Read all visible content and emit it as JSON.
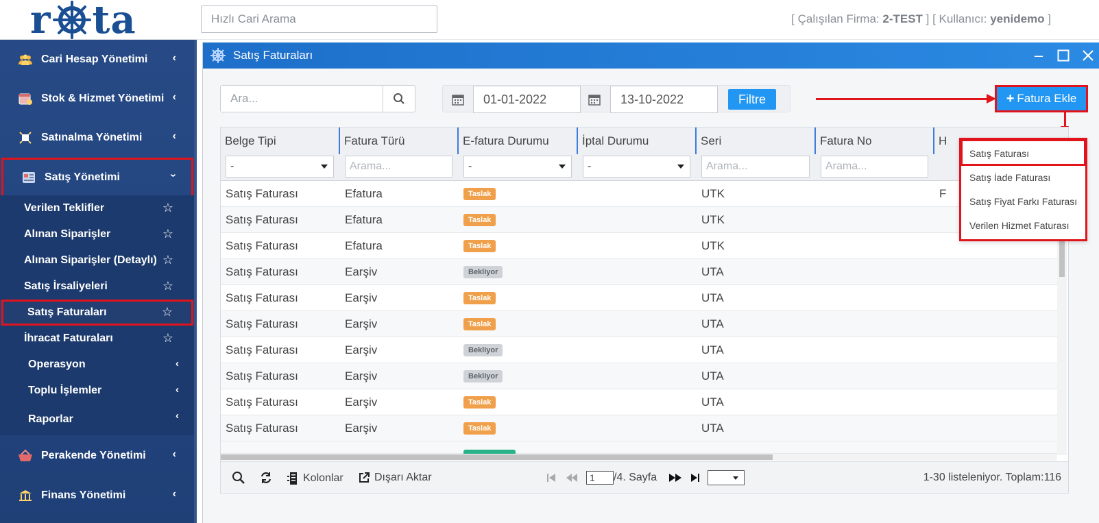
{
  "header": {
    "logo_text": "rota",
    "quick_search_placeholder": "Hızlı Cari Arama",
    "firm_label": "[ Çalışılan Firma: ",
    "firm_value": "2-TEST",
    "user_label": " ] [ Kullanıcı: ",
    "user_value": "yenidemo",
    "user_suffix": " ]"
  },
  "sidebar": {
    "main_items": [
      {
        "label": "Cari Hesap Yönetimi",
        "icon": "users-icon"
      },
      {
        "label": "Stok & Hizmet Yönetimi",
        "icon": "calendar-box-icon"
      },
      {
        "label": "Satınalma Yönetimi",
        "icon": "bug-icon"
      },
      {
        "label": "Satış Yönetimi",
        "icon": "invoice-icon",
        "active": true
      }
    ],
    "sub_items": [
      {
        "label": "Verilen Teklifler"
      },
      {
        "label": "Alınan Siparişler"
      },
      {
        "label": "Alınan Siparişler (Detaylı)"
      },
      {
        "label": "Satış İrsaliyeleri"
      },
      {
        "label": "Satış Faturaları",
        "active": true
      },
      {
        "label": "İhracat Faturaları"
      }
    ],
    "groups": [
      {
        "label": "Operasyon"
      },
      {
        "label": "Toplu İşlemler"
      },
      {
        "label": "Raporlar"
      }
    ],
    "bottom_items": [
      {
        "label": "Perakende Yönetimi",
        "icon": "basket-icon"
      },
      {
        "label": "Finans Yönetimi",
        "icon": "bank-icon"
      }
    ]
  },
  "window": {
    "title": "Satış Faturaları",
    "search_placeholder": "Ara...",
    "date_from": "01-01-2022",
    "date_to": "13-10-2022",
    "filter_label": "Filtre",
    "add_invoice_label": "Fatura Ekle",
    "dropdown": [
      "Satış Faturası",
      "Satış İade Faturası",
      "Satış Fiyat Farkı Faturası",
      "Verilen Hizmet Faturası"
    ]
  },
  "grid": {
    "columns": [
      "Belge Tipi",
      "Fatura Türü",
      "E-fatura Durumu",
      "İptal Durumu",
      "Seri",
      "Fatura No",
      "H"
    ],
    "filters": [
      "-",
      "Arama...",
      "-",
      "-",
      "Arama...",
      "Arama..."
    ],
    "rows": [
      {
        "belge": "Satış Faturası",
        "tur": "Efatura",
        "durum": "Taslak",
        "seri": "UTK",
        "extra": "F"
      },
      {
        "belge": "Satış Faturası",
        "tur": "Efatura",
        "durum": "Taslak",
        "seri": "UTK",
        "extra": ""
      },
      {
        "belge": "Satış Faturası",
        "tur": "Efatura",
        "durum": "Taslak",
        "seri": "UTK",
        "extra": ""
      },
      {
        "belge": "Satış Faturası",
        "tur": "Earşiv",
        "durum": "Bekliyor",
        "seri": "UTA",
        "extra": ""
      },
      {
        "belge": "Satış Faturası",
        "tur": "Earşiv",
        "durum": "Taslak",
        "seri": "UTA",
        "extra": ""
      },
      {
        "belge": "Satış Faturası",
        "tur": "Earşiv",
        "durum": "Taslak",
        "seri": "UTA",
        "extra": ""
      },
      {
        "belge": "Satış Faturası",
        "tur": "Earşiv",
        "durum": "Bekliyor",
        "seri": "UTA",
        "extra": ""
      },
      {
        "belge": "Satış Faturası",
        "tur": "Earşiv",
        "durum": "Bekliyor",
        "seri": "UTA",
        "extra": ""
      },
      {
        "belge": "Satış Faturası",
        "tur": "Earşiv",
        "durum": "Taslak",
        "seri": "UTA",
        "extra": ""
      },
      {
        "belge": "Satış Faturası",
        "tur": "Earşiv",
        "durum": "Taslak",
        "seri": "UTA",
        "extra": ""
      }
    ],
    "status_colors": {
      "Taslak": "#f0a04b",
      "Bekliyor": "#cfd3d7"
    }
  },
  "pager": {
    "columns_label": "Kolonlar",
    "export_label": "Dışarı Aktar",
    "page_value": "1",
    "page_total": "/4. Sayfa",
    "summary": "1-30 listeleniyor. Toplam:116"
  },
  "colors": {
    "accent": "#2196f3",
    "highlight": "#e1141b",
    "sidebar": "#274a86"
  }
}
